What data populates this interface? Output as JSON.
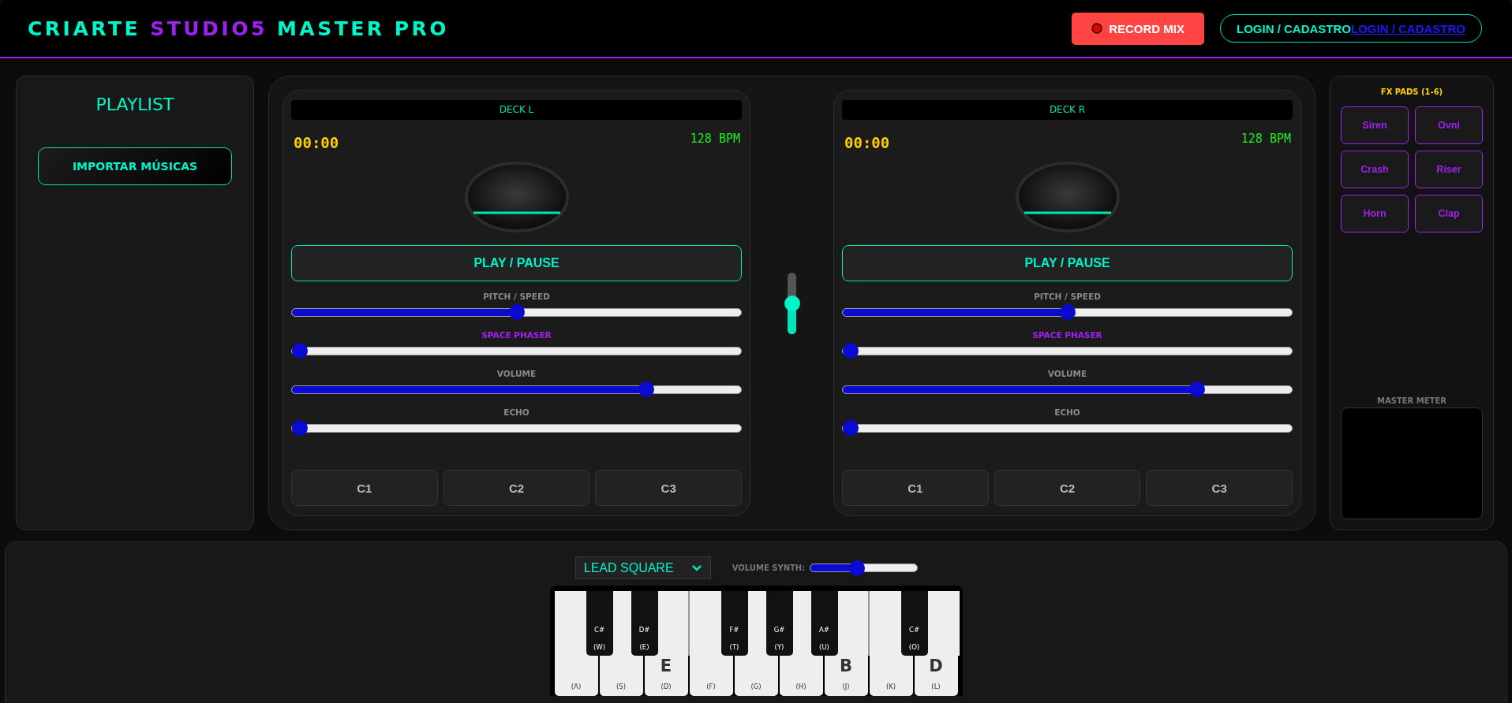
{
  "header": {
    "title": [
      {
        "text": "CRIARTE ",
        "accent": false
      },
      {
        "text": "STUDIO5",
        "accent": true
      },
      {
        "text": " MASTER PRO",
        "accent": false
      }
    ],
    "record_button": {
      "label": "RECORD MIX"
    },
    "login_button": {
      "label": "LOGIN / CADASTRO",
      "link": "LOGIN / CADASTRO"
    }
  },
  "playlist": {
    "title": "PLAYLIST",
    "import_button": "IMPORTAR MÚSICAS"
  },
  "decks": [
    {
      "title": "DECK L",
      "time": "00:00",
      "bpm": "128 BPM",
      "play_button": "PLAY / PAUSE",
      "controls": [
        {
          "label": "PITCH / SPEED",
          "highlight": false,
          "level": 0.5
        },
        {
          "label": "SPACE PHASER",
          "highlight": true,
          "level": 0
        },
        {
          "label": "VOLUME",
          "highlight": false,
          "level": 0.8
        },
        {
          "label": "ECHO",
          "highlight": false,
          "level": 0
        }
      ],
      "cues": [
        "C1",
        "C2",
        "C3"
      ]
    },
    {
      "title": "DECK R",
      "time": "00:00",
      "bpm": "128 BPM",
      "play_button": "PLAY / PAUSE",
      "controls": [
        {
          "label": "PITCH / SPEED",
          "highlight": false,
          "level": 0.5
        },
        {
          "label": "SPACE PHASER",
          "highlight": true,
          "level": 0
        },
        {
          "label": "VOLUME",
          "highlight": false,
          "level": 0.8
        },
        {
          "label": "ECHO",
          "highlight": false,
          "level": 0
        }
      ],
      "cues": [
        "C1",
        "C2",
        "C3"
      ]
    }
  ],
  "crossfader": {
    "level": 0.5
  },
  "fx": {
    "title": "FX PADS (1-6)",
    "pads": [
      "Siren",
      "Ovni",
      "Crash",
      "Riser",
      "Horn",
      "Clap"
    ],
    "meter_label": "MASTER METER"
  },
  "synth": {
    "preset": "LEAD SQUARE",
    "volume": {
      "label": "VOLUME SYNTH:",
      "level": 0.42
    },
    "keys": [
      {
        "kind": "white",
        "key": "(A)"
      },
      {
        "kind": "black",
        "note": "C#",
        "key": "(W)"
      },
      {
        "kind": "white",
        "key": "(S)"
      },
      {
        "kind": "black",
        "note": "D#",
        "key": "(E)"
      },
      {
        "kind": "white",
        "note": "E",
        "key": "(D)"
      },
      {
        "kind": "white",
        "key": "(F)"
      },
      {
        "kind": "black",
        "note": "F#",
        "key": "(T)"
      },
      {
        "kind": "white",
        "key": "(G)"
      },
      {
        "kind": "black",
        "note": "G#",
        "key": "(Y)"
      },
      {
        "kind": "white",
        "key": "(H)"
      },
      {
        "kind": "black",
        "note": "A#",
        "key": "(U)"
      },
      {
        "kind": "white",
        "note": "B",
        "key": "(J)"
      },
      {
        "kind": "white",
        "key": "(K)"
      },
      {
        "kind": "black",
        "note": "C#",
        "key": "(O)"
      },
      {
        "kind": "white",
        "note": "D",
        "key": "(L)"
      }
    ]
  }
}
